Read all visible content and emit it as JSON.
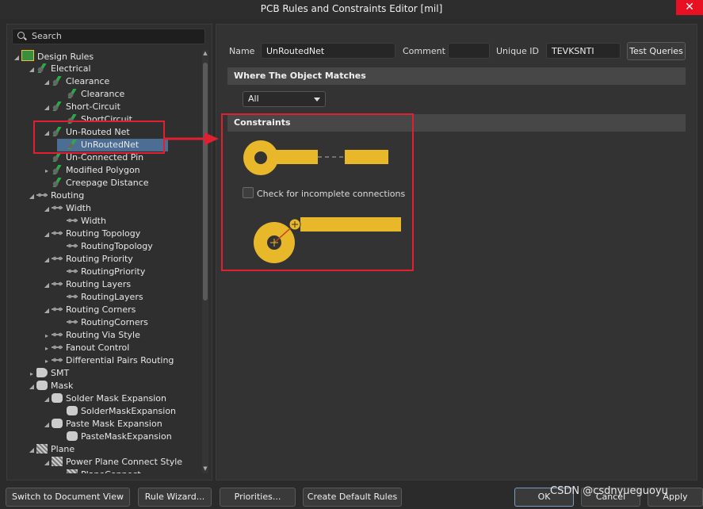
{
  "window": {
    "title": "PCB Rules and Constraints Editor [mil]",
    "close": "✕"
  },
  "search": {
    "placeholder": "Search"
  },
  "tree": [
    {
      "label": "Design Rules",
      "arrow": "◢",
      "icon": "rules-icon"
    },
    {
      "label": "Electrical",
      "arrow": "◢",
      "icon": "electrical-rule-icon"
    },
    {
      "label": "Clearance",
      "arrow": "◢",
      "icon": "electrical-rule-icon"
    },
    {
      "label": "Clearance",
      "arrow": "",
      "icon": "electrical-rule-icon"
    },
    {
      "label": "Short-Circuit",
      "arrow": "◢",
      "icon": "electrical-rule-icon"
    },
    {
      "label": "ShortCircuit",
      "arrow": "",
      "icon": "electrical-rule-icon"
    },
    {
      "label": "Un-Routed Net",
      "arrow": "◢",
      "icon": "electrical-rule-icon"
    },
    {
      "label": "UnRoutedNet",
      "arrow": "",
      "icon": "electrical-rule-icon",
      "selected": true
    },
    {
      "label": "Un-Connected Pin",
      "arrow": "",
      "icon": "electrical-rule-icon"
    },
    {
      "label": "Modified Polygon",
      "arrow": "▸",
      "icon": "electrical-rule-icon"
    },
    {
      "label": "Creepage Distance",
      "arrow": "",
      "icon": "electrical-rule-icon"
    },
    {
      "label": "Routing",
      "arrow": "◢",
      "icon": "routing-rule-icon"
    },
    {
      "label": "Width",
      "arrow": "◢",
      "icon": "routing-rule-icon"
    },
    {
      "label": "Width",
      "arrow": "",
      "icon": "routing-rule-icon"
    },
    {
      "label": "Routing Topology",
      "arrow": "◢",
      "icon": "routing-rule-icon"
    },
    {
      "label": "RoutingTopology",
      "arrow": "",
      "icon": "routing-rule-icon"
    },
    {
      "label": "Routing Priority",
      "arrow": "◢",
      "icon": "routing-rule-icon"
    },
    {
      "label": "RoutingPriority",
      "arrow": "",
      "icon": "routing-rule-icon"
    },
    {
      "label": "Routing Layers",
      "arrow": "◢",
      "icon": "routing-rule-icon"
    },
    {
      "label": "RoutingLayers",
      "arrow": "",
      "icon": "routing-rule-icon"
    },
    {
      "label": "Routing Corners",
      "arrow": "◢",
      "icon": "routing-rule-icon"
    },
    {
      "label": "RoutingCorners",
      "arrow": "",
      "icon": "routing-rule-icon"
    },
    {
      "label": "Routing Via Style",
      "arrow": "▸",
      "icon": "routing-rule-icon"
    },
    {
      "label": "Fanout Control",
      "arrow": "▸",
      "icon": "routing-rule-icon"
    },
    {
      "label": "Differential Pairs Routing",
      "arrow": "▸",
      "icon": "routing-rule-icon"
    },
    {
      "label": "SMT",
      "arrow": "▸",
      "icon": "smt-rule-icon"
    },
    {
      "label": "Mask",
      "arrow": "◢",
      "icon": "mask-rule-icon"
    },
    {
      "label": "Solder Mask Expansion",
      "arrow": "◢",
      "icon": "mask-rule-icon"
    },
    {
      "label": "SolderMaskExpansion",
      "arrow": "",
      "icon": "mask-rule-icon"
    },
    {
      "label": "Paste Mask Expansion",
      "arrow": "◢",
      "icon": "mask-rule-icon"
    },
    {
      "label": "PasteMaskExpansion",
      "arrow": "",
      "icon": "mask-rule-icon"
    },
    {
      "label": "Plane",
      "arrow": "◢",
      "icon": "plane-rule-icon"
    },
    {
      "label": "Power Plane Connect Style",
      "arrow": "◢",
      "icon": "plane-rule-icon"
    },
    {
      "label": "PlaneConnect",
      "arrow": "",
      "icon": "plane-rule-icon"
    }
  ],
  "rule": {
    "name_label": "Name",
    "name_value": "UnRoutedNet",
    "comment_label": "Comment",
    "comment_value": "",
    "uid_label": "Unique ID",
    "uid_value": "TEVKSNTI",
    "test_queries": "Test Queries"
  },
  "where": {
    "header": "Where The Object Matches",
    "scope": "All"
  },
  "constraints": {
    "header": "Constraints",
    "check_label": "Check for incomplete connections",
    "checked": false
  },
  "bottom": {
    "switch_view": "Switch to Document View",
    "rule_wizard": "Rule Wizard...",
    "priorities": "Priorities...",
    "create_defaults": "Create Default Rules",
    "ok": "OK",
    "cancel": "Cancel",
    "apply": "Apply"
  },
  "watermark": "CSDN @csdnyueguoyu",
  "colors": {
    "accent": "#e8b82a",
    "highlight": "#e02030",
    "selection": "#4d6e94"
  }
}
